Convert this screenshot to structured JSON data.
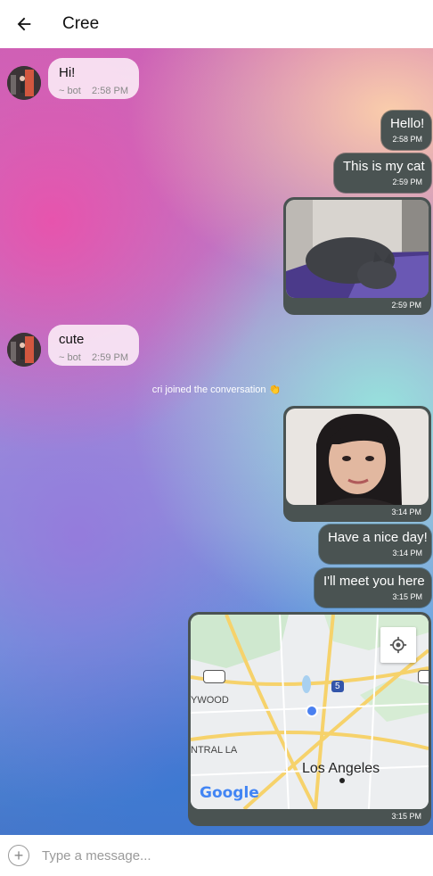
{
  "header": {
    "title": "Cree",
    "back_icon": "arrow-left-icon"
  },
  "messages": [
    {
      "from": "bot",
      "text": "Hi!",
      "sender": "~ bot",
      "time": "2:58 PM"
    },
    {
      "from": "me",
      "text": "Hello!",
      "time": "2:58 PM"
    },
    {
      "from": "me",
      "text": "This is my cat",
      "time": "2:59 PM"
    },
    {
      "from": "me",
      "type": "image",
      "image": "cat-photo",
      "time": "2:59 PM"
    },
    {
      "from": "bot",
      "text": "cute",
      "sender": "~ bot",
      "time": "2:59 PM"
    },
    {
      "from": "system",
      "text": "cri joined the conversation 👏"
    },
    {
      "from": "me",
      "type": "image",
      "image": "woman-portrait",
      "time": "3:14 PM"
    },
    {
      "from": "me",
      "text": "Have a nice day!",
      "time": "3:14 PM"
    },
    {
      "from": "me",
      "text": "I'll meet you here",
      "time": "3:15 PM"
    },
    {
      "from": "me",
      "type": "map",
      "time": "3:15 PM",
      "map": {
        "city": "Los Angeles",
        "labels": [
          "101",
          "5",
          "110",
          "YWOOD",
          "NTRAL LA"
        ],
        "brand": "Google",
        "locate_icon": "crosshair-icon"
      }
    }
  ],
  "composer": {
    "placeholder": "Type a message...",
    "add_icon": "plus-icon"
  },
  "colors": {
    "my_bubble": "#4a5352",
    "bot_bubble": "#fae8f5",
    "map_pin": "#4a80f0"
  }
}
